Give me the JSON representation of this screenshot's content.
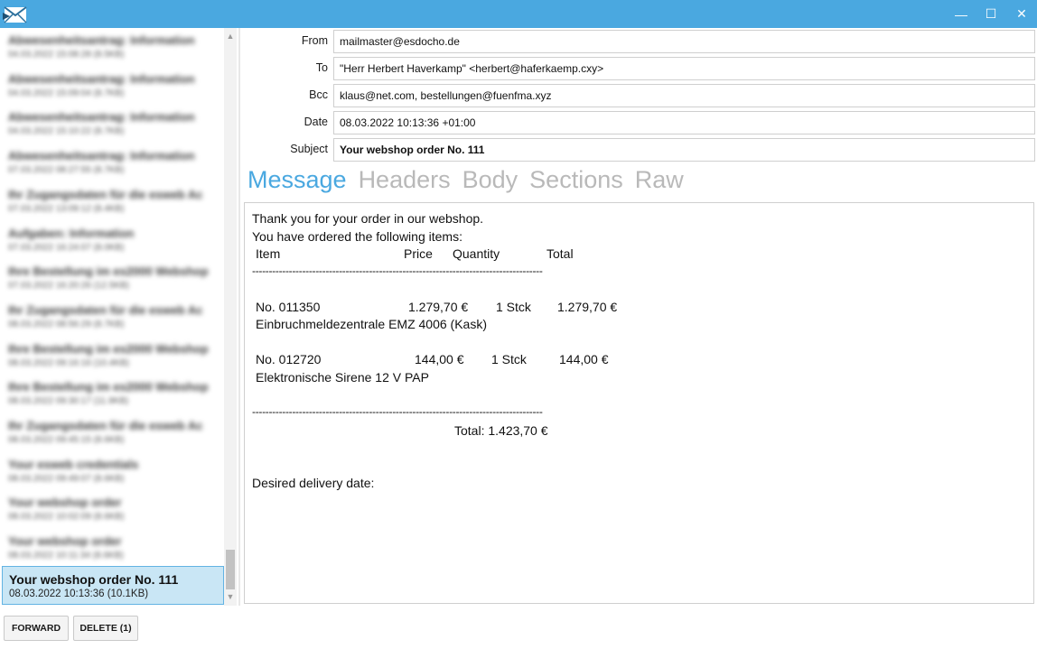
{
  "window": {
    "minimize_glyph": "—",
    "maximize_glyph": "☐",
    "close_glyph": "✕"
  },
  "message_list": {
    "items": [
      {
        "subject": "Abwesenheitsantrag: Information",
        "meta": "04.03.2022 15:08:28 (8.5KB)"
      },
      {
        "subject": "Abwesenheitsantrag: Information",
        "meta": "04.03.2022 15:09:04 (8.7KB)"
      },
      {
        "subject": "Abwesenheitsantrag: Information",
        "meta": "04.03.2022 15:10:22 (8.7KB)"
      },
      {
        "subject": "Abwesenheitsantrag: Information",
        "meta": "07.03.2022 08:27:55 (8.7KB)"
      },
      {
        "subject": "Ihr Zugangsdaten für die esweb Ac",
        "meta": "07.03.2022 13:09:12 (8.4KB)"
      },
      {
        "subject": "Aufgaben: Information",
        "meta": "07.03.2022 16:24:07 (8.0KB)"
      },
      {
        "subject": "Ihre Bestellung im es2000 Webshop",
        "meta": "07.03.2022 16:20:26 (12.5KB)"
      },
      {
        "subject": "Ihr Zugangsdaten für die esweb Ac",
        "meta": "08.03.2022 08:56:29 (8.7KB)"
      },
      {
        "subject": "Ihre Bestellung im es2000 Webshop",
        "meta": "08.03.2022 09:16:16 (10.4KB)"
      },
      {
        "subject": "Ihre Bestellung im es2000 Webshop",
        "meta": "08.03.2022 09:30:17 (11.9KB)"
      },
      {
        "subject": "Ihr Zugangsdaten für die esweb Ac",
        "meta": "08.03.2022 09:45:15 (8.6KB)"
      },
      {
        "subject": "Your esweb credentials",
        "meta": "08.03.2022 09:49:07 (8.6KB)"
      },
      {
        "subject": "Your webshop order",
        "meta": "08.03.2022 10:02:09 (8.6KB)"
      },
      {
        "subject": "Your webshop order",
        "meta": "08.03.2022 10:11:34 (8.6KB)"
      }
    ],
    "selected": {
      "subject": "Your webshop order No. 111",
      "meta": "08.03.2022 10:13:36 (10.1KB)"
    },
    "scroll_up": "▲",
    "scroll_down": "▼"
  },
  "buttons": {
    "forward": "FORWARD",
    "delete": "DELETE (1)"
  },
  "header": {
    "from_label": "From",
    "from": "mailmaster@esdocho.de",
    "to_label": "To",
    "to": "\"Herr Herbert Haverkamp\" <herbert@haferkaemp.cxy>",
    "bcc_label": "Bcc",
    "bcc": "klaus@net.com, bestellungen@fuenfma.xyz",
    "date_label": "Date",
    "date": "08.03.2022 10:13:36 +01:00",
    "subject_label": "Subject",
    "subject": "Your webshop order No. 111"
  },
  "tabs": [
    "Message",
    "Headers",
    "Body",
    "Sections",
    "Raw"
  ],
  "body": {
    "line1": "Thank you for your order in our webshop.",
    "line2": "You have ordered the following items:",
    "col_item": "Item",
    "col_price": "Price",
    "col_quantity": "Quantity",
    "col_total": "Total",
    "rule": "---------------------------------------------------------------------------------------",
    "items": [
      {
        "no": "No. 011350",
        "price": "1.279,70 €",
        "qty": "1 Stck",
        "total": "1.279,70 €",
        "desc": "Einbruchmeldezentrale EMZ 4006 (Kask)"
      },
      {
        "no": "No. 012720",
        "price": "144,00 €",
        "qty": "1 Stck",
        "total": "144,00 €",
        "desc": "Elektronische Sirene 12 V PAP"
      }
    ],
    "total": "Total: 1.423,70 €",
    "delivery": "Desired delivery date:"
  }
}
